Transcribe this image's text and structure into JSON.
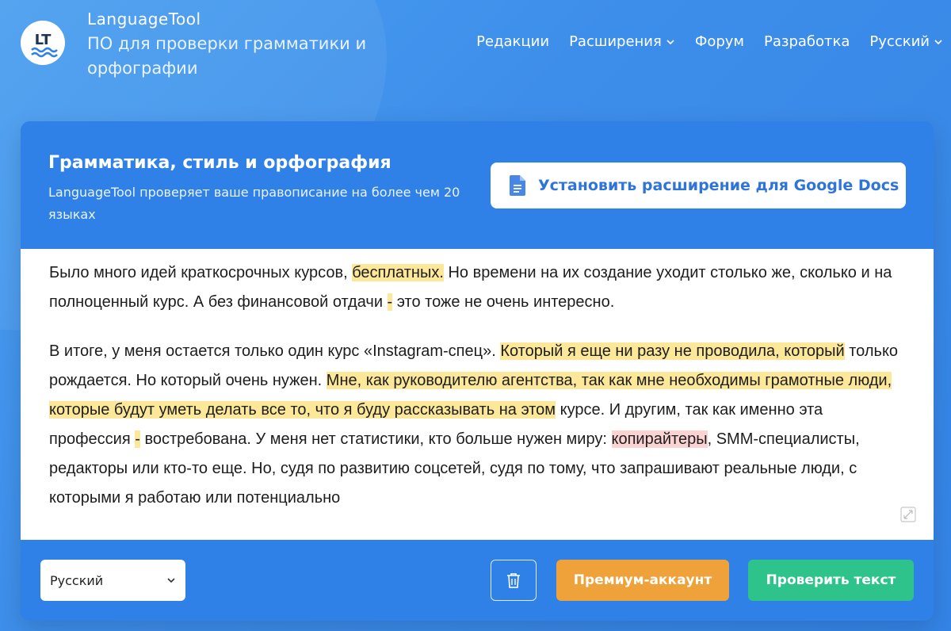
{
  "header": {
    "brand_name": "LanguageTool",
    "tagline": "ПО для проверки грамматики и орфографии",
    "logo_text": "LT",
    "nav": [
      {
        "label": "Редакции",
        "has_dropdown": false
      },
      {
        "label": "Расширения",
        "has_dropdown": true
      },
      {
        "label": "Форум",
        "has_dropdown": false
      },
      {
        "label": "Разработка",
        "has_dropdown": false
      },
      {
        "label": "Русский",
        "has_dropdown": true
      }
    ]
  },
  "card": {
    "title": "Грамматика, стиль и орфография",
    "subtitle": "LanguageTool проверяет ваше правописание на более чем 20 языках",
    "gdocs_button": {
      "label": "Установить расширение для Google Docs",
      "icon": "document-icon"
    }
  },
  "editor": {
    "paragraphs": [
      [
        {
          "text": "Было много идей краткосрочных курсов, ",
          "hl": ""
        },
        {
          "text": "бесплатных.",
          "hl": "y"
        },
        {
          "text": " Но времени на их создание уходит столько же, сколько и на полноценный курс. А без финансовой отдачи ",
          "hl": ""
        },
        {
          "text": "-",
          "hl": "y"
        },
        {
          "text": " это тоже не очень интересно.",
          "hl": ""
        }
      ],
      [
        {
          "text": "В итоге, у меня остается только один курс «Instagram-спец». ",
          "hl": ""
        },
        {
          "text": "Который я еще ни разу не проводила, который",
          "hl": "y"
        },
        {
          "text": " только рождается. Но который очень нужен. ",
          "hl": ""
        },
        {
          "text": "Мне, как руководителю агентства, так как мне необходимы грамотные люди, которые будут уметь делать все то, что я буду рассказывать на этом",
          "hl": "y"
        },
        {
          "text": " курсе. И другим, так как именно эта профессия ",
          "hl": ""
        },
        {
          "text": "-",
          "hl": "y"
        },
        {
          "text": " востребована. У меня нет статистики, кто больше нужен миру: ",
          "hl": ""
        },
        {
          "text": "копирайтеры",
          "hl": "r"
        },
        {
          "text": ", SMM-специалисты, редакторы или кто-то еще. Но, судя по развитию соцсетей, судя по тому, что запрашивают реальные люди, с которыми я работаю или потенциально",
          "hl": ""
        }
      ]
    ]
  },
  "footer": {
    "language_select": "Русский",
    "premium_label": "Премиум-аккаунт",
    "check_label": "Проверить текст"
  },
  "colors": {
    "background": "#3d8eea",
    "card_blue": "#2f80e7",
    "highlight_yellow": "#fde89a",
    "highlight_red": "#fbd3d3",
    "premium": "#f0a23a",
    "check": "#2dc38a"
  }
}
